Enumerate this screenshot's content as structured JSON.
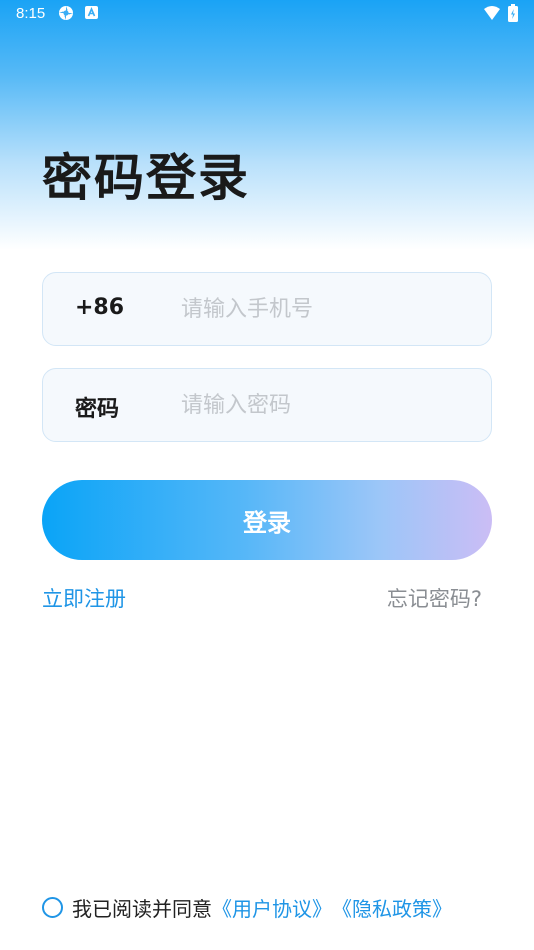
{
  "status_bar": {
    "time": "8:15",
    "icons": [
      "settings-gear-icon",
      "app-a-icon",
      "wifi-icon",
      "battery-icon"
    ]
  },
  "page": {
    "title": "密码登录"
  },
  "phone_field": {
    "label": "+86",
    "placeholder": "请输入手机号",
    "value": ""
  },
  "password_field": {
    "label": "密码",
    "placeholder": "请输入密码",
    "value": ""
  },
  "login_button": {
    "label": "登录"
  },
  "links": {
    "register": "立即注册",
    "forgot_password": "忘记密码?"
  },
  "agreement": {
    "checked": false,
    "text": "我已阅读并同意",
    "user_agreement": "《用户协议》",
    "privacy_policy": "《隐私政策》"
  },
  "colors": {
    "accent": "#1f95e6",
    "hero_top": "#1aa3f5",
    "button_start": "#0aa4f7",
    "button_end": "#cbbdf5",
    "muted_text": "#8a8e93"
  }
}
